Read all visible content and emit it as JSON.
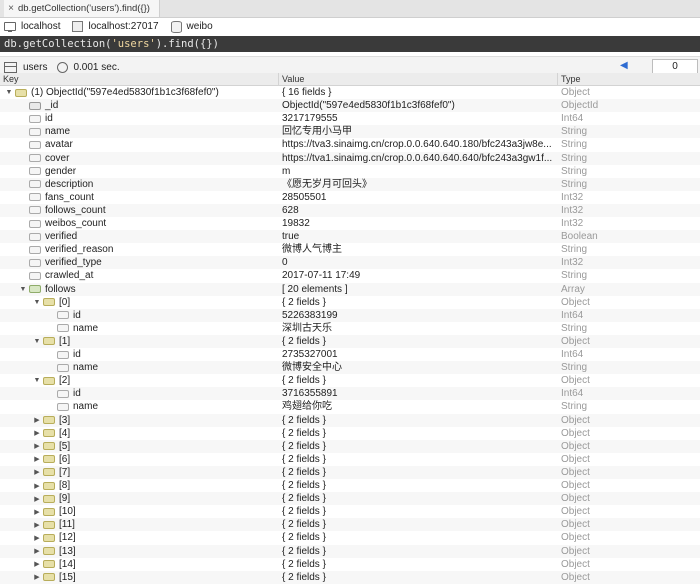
{
  "tab": {
    "title": "db.getCollection('users').find({})",
    "close": "×"
  },
  "connection": {
    "host": "localhost",
    "server": "localhost:27017",
    "db": "weibo"
  },
  "query": {
    "prefix": "db.getCollection(",
    "string": "'users'",
    "suffix": ").find({})"
  },
  "results": {
    "collection": "users",
    "time": "0.001 sec.",
    "page_prev": "◀",
    "page_value": "0"
  },
  "columns": {
    "key": "Key",
    "value": "Value",
    "type": "Type"
  },
  "rows": [
    {
      "depth": 0,
      "tri": "▼",
      "icon": "obj",
      "key": "(1) ObjectId(\"597e4ed5830f1b1c3f68fef0\")",
      "value": "{ 16 fields }",
      "type": "Object"
    },
    {
      "depth": 1,
      "tri": "",
      "icon": "id",
      "key": "_id",
      "value": "ObjectId(\"597e4ed5830f1b1c3f68fef0\")",
      "type": "ObjectId"
    },
    {
      "depth": 1,
      "tri": "",
      "icon": "field",
      "key": "id",
      "value": "3217179555",
      "type": "Int64"
    },
    {
      "depth": 1,
      "tri": "",
      "icon": "field",
      "key": "name",
      "value": "回忆专用小马甲",
      "type": "String"
    },
    {
      "depth": 1,
      "tri": "",
      "icon": "field",
      "key": "avatar",
      "value": "https://tva3.sinaimg.cn/crop.0.0.640.640.180/bfc243a3jw8e...",
      "type": "String"
    },
    {
      "depth": 1,
      "tri": "",
      "icon": "field",
      "key": "cover",
      "value": "https://tva1.sinaimg.cn/crop.0.0.640.640.640/bfc243a3gw1f...",
      "type": "String"
    },
    {
      "depth": 1,
      "tri": "",
      "icon": "field",
      "key": "gender",
      "value": "m",
      "type": "String"
    },
    {
      "depth": 1,
      "tri": "",
      "icon": "field",
      "key": "description",
      "value": "《愿无岁月可回头》",
      "type": "String"
    },
    {
      "depth": 1,
      "tri": "",
      "icon": "field",
      "key": "fans_count",
      "value": "28505501",
      "type": "Int32"
    },
    {
      "depth": 1,
      "tri": "",
      "icon": "field",
      "key": "follows_count",
      "value": "628",
      "type": "Int32"
    },
    {
      "depth": 1,
      "tri": "",
      "icon": "field",
      "key": "weibos_count",
      "value": "19832",
      "type": "Int32"
    },
    {
      "depth": 1,
      "tri": "",
      "icon": "field",
      "key": "verified",
      "value": "true",
      "type": "Boolean"
    },
    {
      "depth": 1,
      "tri": "",
      "icon": "field",
      "key": "verified_reason",
      "value": "微博人气博主",
      "type": "String"
    },
    {
      "depth": 1,
      "tri": "",
      "icon": "field",
      "key": "verified_type",
      "value": "0",
      "type": "Int32"
    },
    {
      "depth": 1,
      "tri": "",
      "icon": "field",
      "key": "crawled_at",
      "value": "2017-07-11 17:49",
      "type": "String"
    },
    {
      "depth": 1,
      "tri": "▼",
      "icon": "arr",
      "key": "follows",
      "value": "[ 20 elements ]",
      "type": "Array"
    },
    {
      "depth": 2,
      "tri": "▼",
      "icon": "obj",
      "key": "[0]",
      "value": "{ 2 fields }",
      "type": "Object"
    },
    {
      "depth": 3,
      "tri": "",
      "icon": "field",
      "key": "id",
      "value": "5226383199",
      "type": "Int64"
    },
    {
      "depth": 3,
      "tri": "",
      "icon": "field",
      "key": "name",
      "value": "深圳古天乐",
      "type": "String"
    },
    {
      "depth": 2,
      "tri": "▼",
      "icon": "obj",
      "key": "[1]",
      "value": "{ 2 fields }",
      "type": "Object"
    },
    {
      "depth": 3,
      "tri": "",
      "icon": "field",
      "key": "id",
      "value": "2735327001",
      "type": "Int64"
    },
    {
      "depth": 3,
      "tri": "",
      "icon": "field",
      "key": "name",
      "value": "微博安全中心",
      "type": "String"
    },
    {
      "depth": 2,
      "tri": "▼",
      "icon": "obj",
      "key": "[2]",
      "value": "{ 2 fields }",
      "type": "Object"
    },
    {
      "depth": 3,
      "tri": "",
      "icon": "field",
      "key": "id",
      "value": "3716355891",
      "type": "Int64"
    },
    {
      "depth": 3,
      "tri": "",
      "icon": "field",
      "key": "name",
      "value": "鸡翅给你吃",
      "type": "String"
    },
    {
      "depth": 2,
      "tri": "▶",
      "icon": "obj",
      "key": "[3]",
      "value": "{ 2 fields }",
      "type": "Object"
    },
    {
      "depth": 2,
      "tri": "▶",
      "icon": "obj",
      "key": "[4]",
      "value": "{ 2 fields }",
      "type": "Object"
    },
    {
      "depth": 2,
      "tri": "▶",
      "icon": "obj",
      "key": "[5]",
      "value": "{ 2 fields }",
      "type": "Object"
    },
    {
      "depth": 2,
      "tri": "▶",
      "icon": "obj",
      "key": "[6]",
      "value": "{ 2 fields }",
      "type": "Object"
    },
    {
      "depth": 2,
      "tri": "▶",
      "icon": "obj",
      "key": "[7]",
      "value": "{ 2 fields }",
      "type": "Object"
    },
    {
      "depth": 2,
      "tri": "▶",
      "icon": "obj",
      "key": "[8]",
      "value": "{ 2 fields }",
      "type": "Object"
    },
    {
      "depth": 2,
      "tri": "▶",
      "icon": "obj",
      "key": "[9]",
      "value": "{ 2 fields }",
      "type": "Object"
    },
    {
      "depth": 2,
      "tri": "▶",
      "icon": "obj",
      "key": "[10]",
      "value": "{ 2 fields }",
      "type": "Object"
    },
    {
      "depth": 2,
      "tri": "▶",
      "icon": "obj",
      "key": "[11]",
      "value": "{ 2 fields }",
      "type": "Object"
    },
    {
      "depth": 2,
      "tri": "▶",
      "icon": "obj",
      "key": "[12]",
      "value": "{ 2 fields }",
      "type": "Object"
    },
    {
      "depth": 2,
      "tri": "▶",
      "icon": "obj",
      "key": "[13]",
      "value": "{ 2 fields }",
      "type": "Object"
    },
    {
      "depth": 2,
      "tri": "▶",
      "icon": "obj",
      "key": "[14]",
      "value": "{ 2 fields }",
      "type": "Object"
    },
    {
      "depth": 2,
      "tri": "▶",
      "icon": "obj",
      "key": "[15]",
      "value": "{ 2 fields }",
      "type": "Object"
    }
  ]
}
